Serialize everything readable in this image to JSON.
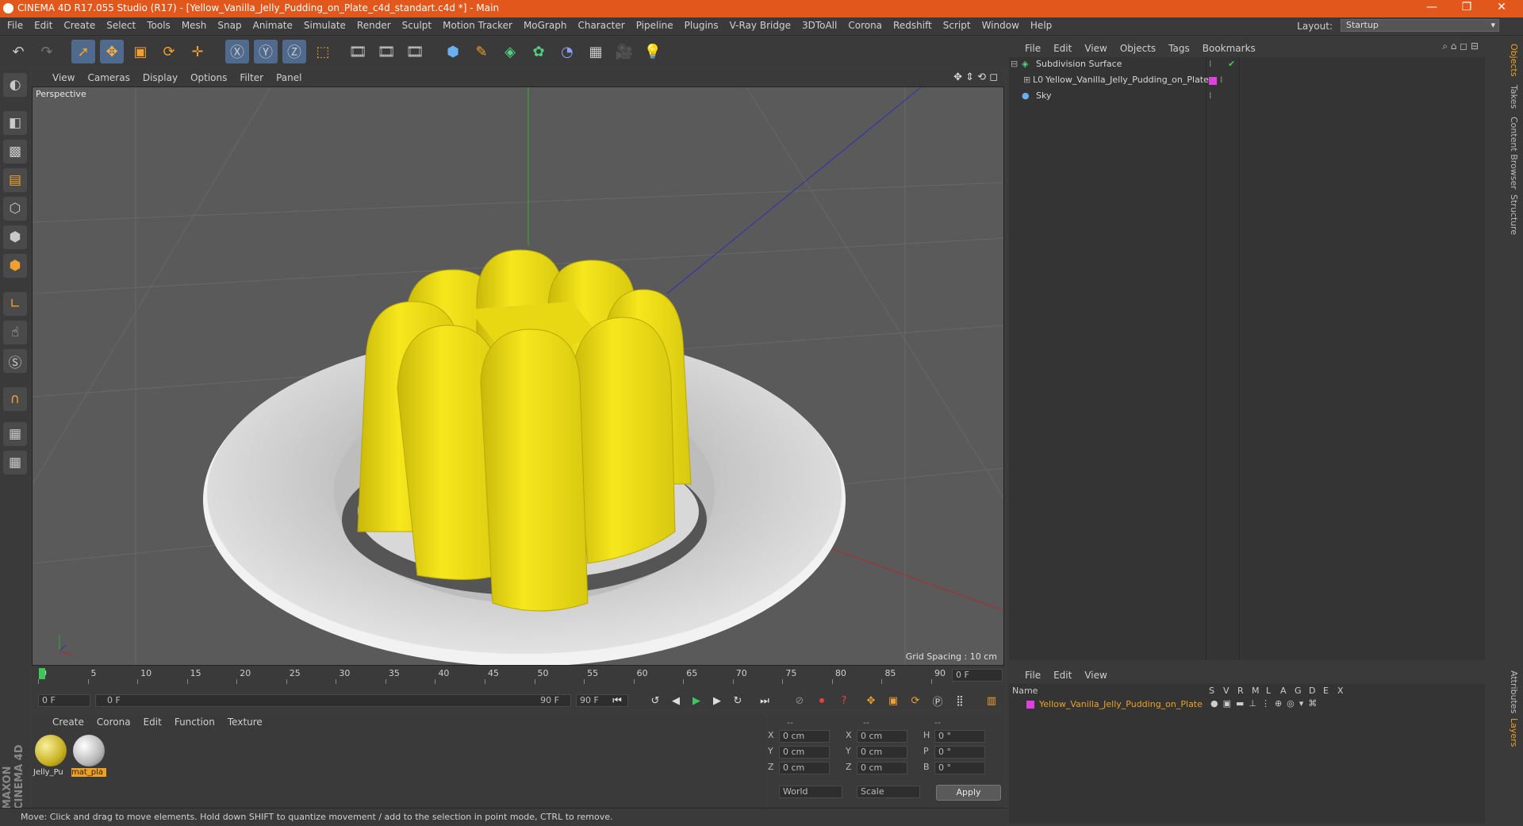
{
  "window": {
    "title": "CINEMA 4D R17.055 Studio (R17) - [Yellow_Vanilla_Jelly_Pudding_on_Plate_c4d_standart.c4d *] - Main"
  },
  "menu": [
    "File",
    "Edit",
    "Create",
    "Select",
    "Tools",
    "Mesh",
    "Snap",
    "Animate",
    "Simulate",
    "Render",
    "Sculpt",
    "Motion Tracker",
    "MoGraph",
    "Character",
    "Pipeline",
    "Plugins",
    "V-Ray Bridge",
    "3DToAll",
    "Corona",
    "Redshift",
    "Script",
    "Window",
    "Help"
  ],
  "layout": {
    "label": "Layout:",
    "value": "Startup"
  },
  "viewport": {
    "menu": [
      "View",
      "Cameras",
      "Display",
      "Options",
      "Filter",
      "Panel"
    ],
    "label": "Perspective",
    "grid_spacing": "Grid Spacing : 10 cm"
  },
  "timeline": {
    "ticks": [
      "0",
      "5",
      "10",
      "15",
      "20",
      "25",
      "30",
      "35",
      "40",
      "45",
      "50",
      "55",
      "60",
      "65",
      "70",
      "75",
      "80",
      "85",
      "90"
    ],
    "current_frame": "0 F",
    "start_field": "0 F",
    "range_start": "0 F",
    "range_end": "90 F",
    "end_field": "90 F"
  },
  "materials": {
    "menu": [
      "Create",
      "Corona",
      "Edit",
      "Function",
      "Texture"
    ],
    "items": [
      {
        "label": "Jelly_Pu"
      },
      {
        "label": "mat_pla"
      }
    ]
  },
  "coords": {
    "header": [
      "--",
      "--",
      "--"
    ],
    "rows": [
      {
        "a": "X",
        "av": "0 cm",
        "b": "X",
        "bv": "0 cm",
        "c": "H",
        "cv": "0 °"
      },
      {
        "a": "Y",
        "av": "0 cm",
        "b": "Y",
        "bv": "0 cm",
        "c": "P",
        "cv": "0 °"
      },
      {
        "a": "Z",
        "av": "0 cm",
        "b": "Z",
        "bv": "0 cm",
        "c": "B",
        "cv": "0 °"
      }
    ],
    "world": "World",
    "scale": "Scale",
    "apply": "Apply"
  },
  "objects": {
    "menu": [
      "File",
      "Edit",
      "View",
      "Objects",
      "Tags",
      "Bookmarks"
    ],
    "rows": [
      {
        "name": "Subdivision Surface"
      },
      {
        "name": "Yellow_Vanilla_Jelly_Pudding_on_Plate"
      },
      {
        "name": "Sky"
      }
    ]
  },
  "layers": {
    "menu": [
      "File",
      "Edit",
      "View"
    ],
    "name_col": "Name",
    "cols": [
      "S",
      "V",
      "R",
      "M",
      "L",
      "A",
      "G",
      "D",
      "E",
      "X"
    ],
    "row": "Yellow_Vanilla_Jelly_Pudding_on_Plate"
  },
  "side_tabs": [
    "Objects",
    "Takes",
    "Content Browser",
    "Structure",
    "Attributes",
    "Layers"
  ],
  "status": "Move: Click and drag to move elements. Hold down SHIFT to quantize movement / add to the selection in point mode, CTRL to remove.",
  "brand": "MAXON CINEMA 4D",
  "colors": {
    "titlebar": "#e2571b",
    "jelly": "#f2e21a",
    "layer_tag": "#e040e0"
  }
}
